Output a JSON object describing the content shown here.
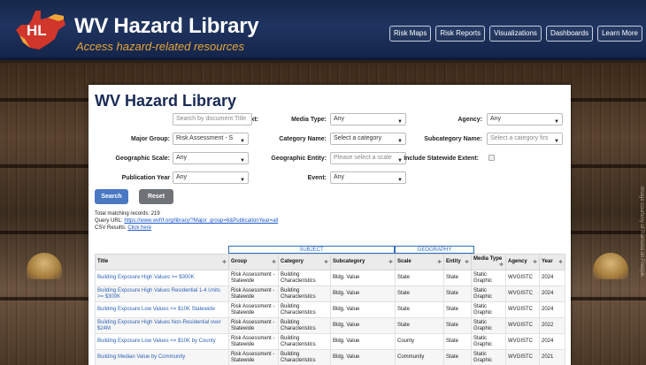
{
  "header": {
    "title": "WV Hazard Library",
    "subtitle": "Access hazard-related resources",
    "logo_letters": "HL",
    "nav": [
      "Risk Maps",
      "Risk Reports",
      "Visualizations",
      "Dashboards",
      "Learn More"
    ]
  },
  "background_credit": "Image courtesy of Ramona on Freepik",
  "page": {
    "title": "WV Hazard Library"
  },
  "form": {
    "free_text": {
      "label": "Free Text:",
      "placeholder": "Search by document Title"
    },
    "media_type": {
      "label": "Media Type:",
      "value": "Any"
    },
    "agency": {
      "label": "Agency:",
      "value": "Any"
    },
    "major_group": {
      "label": "Major Group:",
      "value": "Risk Assessment - S"
    },
    "category_name": {
      "label": "Category Name:",
      "value": "Select a category"
    },
    "subcategory_name": {
      "label": "Subcategory Name:",
      "value": "Select a category firs"
    },
    "geographic_scale": {
      "label": "Geographic Scale:",
      "value": "Any"
    },
    "geographic_entity": {
      "label": "Geographic Entity:",
      "value": "Please select a scale"
    },
    "statewide_extent": {
      "label": "Include Statewide Extent:",
      "checked": false
    },
    "publication_year": {
      "label": "Publication Year",
      "value": "Any"
    },
    "event": {
      "label": "Event:",
      "value": "Any"
    },
    "search_button": "Search",
    "reset_button": "Reset"
  },
  "results": {
    "total_label": "Total matching records: 219",
    "query_label": "Query URL: ",
    "query_url": "https://www.wvfrf.org/library/?Major_group=6&PublicationYear=all",
    "csv_label": "CSV Results: ",
    "csv_link": "Click here"
  },
  "table": {
    "group_headers": {
      "subject": "SUBJECT",
      "geography": "GEOGRAPHY"
    },
    "columns": [
      "Title",
      "Group",
      "Category",
      "Subcategory",
      "Scale",
      "Entity",
      "Media Type",
      "Agency",
      "Year"
    ],
    "sort_glyph": "≑",
    "rows": [
      {
        "title": "Building Exposure High Values >= $300K",
        "group": "Risk Assessment - Statewide",
        "category": "Building Characteristics",
        "subcategory": "Bldg. Value",
        "scale": "State",
        "entity": "State",
        "media": "Static Graphic",
        "agency": "WVGISTC",
        "year": "2024"
      },
      {
        "title": "Building Exposure High Values Residential 1-4 Units >= $300K",
        "group": "Risk Assessment - Statewide",
        "category": "Building Characteristics",
        "subcategory": "Bldg. Value",
        "scale": "State",
        "entity": "State",
        "media": "Static Graphic",
        "agency": "WVGISTC",
        "year": "2024"
      },
      {
        "title": "Building Exposure Low Values <= $10K Statewide",
        "group": "Risk Assessment - Statewide",
        "category": "Building Characteristics",
        "subcategory": "Bldg. Value",
        "scale": "State",
        "entity": "State",
        "media": "Static Graphic",
        "agency": "WVGISTC",
        "year": "2024"
      },
      {
        "title": "Building Exposure High Values Non-Residential over $24M",
        "group": "Risk Assessment - Statewide",
        "category": "Building Characteristics",
        "subcategory": "Bldg. Value",
        "scale": "State",
        "entity": "State",
        "media": "Static Graphic",
        "agency": "WVGISTC",
        "year": "2022"
      },
      {
        "title": "Building Exposure Low Values <= $10K by County",
        "group": "Risk Assessment - Statewide",
        "category": "Building Characteristics",
        "subcategory": "Bldg. Value",
        "scale": "County",
        "entity": "State",
        "media": "Static Graphic",
        "agency": "WVGISTC",
        "year": "2024"
      },
      {
        "title": "Building Median Value by Community",
        "group": "Risk Assessment - Statewide",
        "category": "Building Characteristics",
        "subcategory": "Bldg. Value",
        "scale": "Community",
        "entity": "State",
        "media": "Static Graphic",
        "agency": "WVGISTC",
        "year": "2021"
      }
    ]
  },
  "colors": {
    "header_bg": "#1f3460",
    "accent_orange": "#e8a63a",
    "logo_red": "#d0362a",
    "search_blue": "#4a78c2",
    "link_blue": "#2e63b8"
  }
}
